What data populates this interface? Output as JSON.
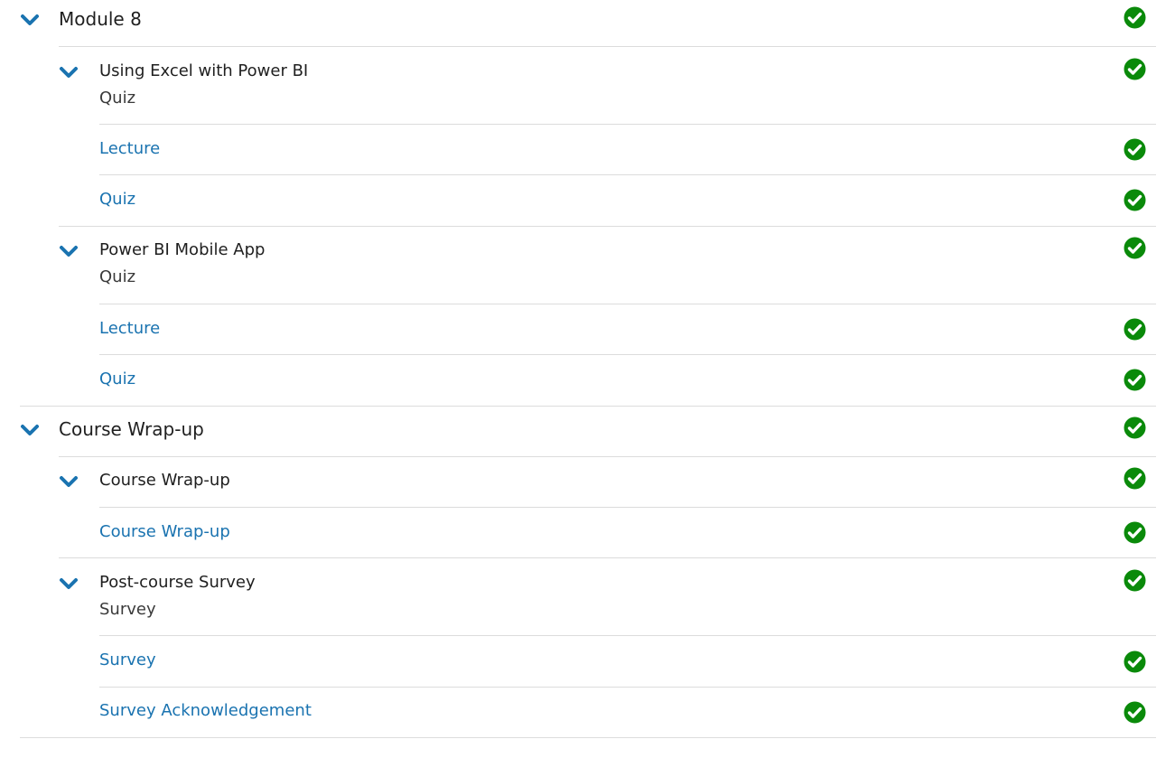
{
  "modules": [
    {
      "title": "Module 8",
      "complete": true,
      "sections": [
        {
          "title": "Using Excel with Power BI",
          "subtitle": "Quiz",
          "complete": true,
          "items": [
            {
              "label": "Lecture",
              "complete": true
            },
            {
              "label": "Quiz",
              "complete": true
            }
          ]
        },
        {
          "title": "Power BI Mobile App",
          "subtitle": "Quiz",
          "complete": true,
          "items": [
            {
              "label": "Lecture",
              "complete": true
            },
            {
              "label": "Quiz",
              "complete": true
            }
          ]
        }
      ]
    },
    {
      "title": "Course Wrap-up",
      "complete": true,
      "sections": [
        {
          "title": "Course Wrap-up",
          "complete": true,
          "items": [
            {
              "label": "Course Wrap-up",
              "complete": true
            }
          ]
        },
        {
          "title": "Post-course Survey",
          "subtitle": "Survey",
          "complete": true,
          "items": [
            {
              "label": "Survey",
              "complete": true
            },
            {
              "label": "Survey Acknowledgement",
              "complete": true
            }
          ]
        }
      ]
    }
  ],
  "colors": {
    "accent": "#1a73b0",
    "complete": "#0a8a0a",
    "divider": "#dcdcdc"
  },
  "icons": {
    "expand": "chevron-down-icon",
    "complete": "check-circle-icon"
  }
}
